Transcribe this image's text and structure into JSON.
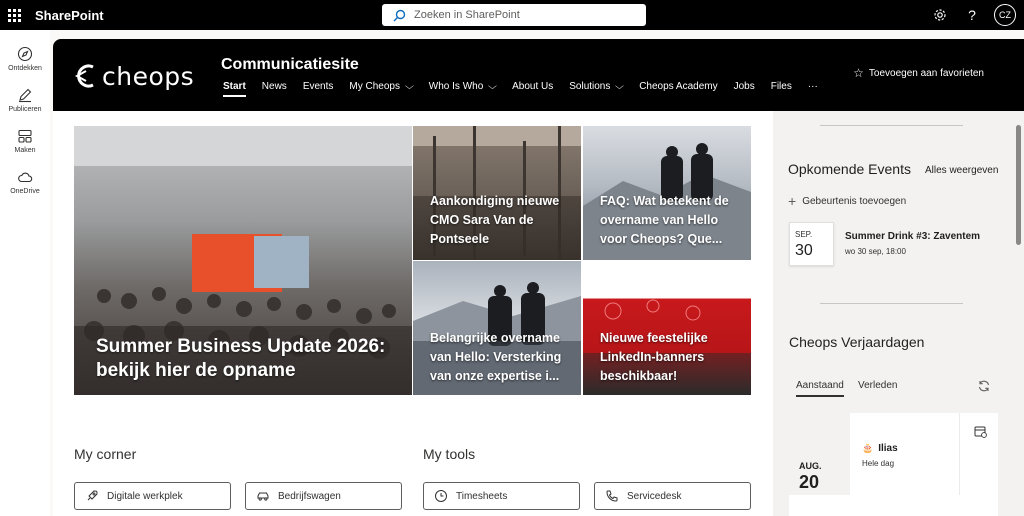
{
  "suitebar": {
    "app_name": "SharePoint",
    "search_placeholder": "Zoeken in SharePoint",
    "avatar_initials": "CZ"
  },
  "appbar": {
    "items": [
      {
        "label": "Ontdekken",
        "icon": "compass-icon"
      },
      {
        "label": "Publiceren",
        "icon": "pen-icon"
      },
      {
        "label": "Maken",
        "icon": "create-icon"
      },
      {
        "label": "OneDrive",
        "icon": "cloud-icon"
      }
    ]
  },
  "site": {
    "logo_text": "cheops",
    "title": "Communicatiesite",
    "nav": [
      {
        "label": "Start",
        "active": true,
        "dropdown": false
      },
      {
        "label": "News",
        "active": false,
        "dropdown": false
      },
      {
        "label": "Events",
        "active": false,
        "dropdown": false
      },
      {
        "label": "My Cheops",
        "active": false,
        "dropdown": true
      },
      {
        "label": "Who Is Who",
        "active": false,
        "dropdown": true
      },
      {
        "label": "About Us",
        "active": false,
        "dropdown": false
      },
      {
        "label": "Solutions",
        "active": false,
        "dropdown": true
      },
      {
        "label": "Cheops Academy",
        "active": false,
        "dropdown": false
      },
      {
        "label": "Jobs",
        "active": false,
        "dropdown": false
      },
      {
        "label": "Files",
        "active": false,
        "dropdown": false
      },
      {
        "label": "···",
        "active": false,
        "dropdown": false
      }
    ],
    "favorite_label": "Toevoegen aan favorieten"
  },
  "hero": {
    "main": "Summer Business Update 2026: bekijk hier de opname",
    "tile_a": "Aankondiging nieuwe CMO Sara Van de Pontseele",
    "tile_b": "FAQ: Wat betekent de overname van Hello voor Cheops? Que...",
    "tile_c": "Belangrijke overname van Hello: Versterking van onze expertise i...",
    "tile_d": "Nieuwe feestelijke LinkedIn-banners beschikbaar!"
  },
  "my_corner": {
    "title": "My corner",
    "links": [
      {
        "label": "Digitale werkplek",
        "icon": "rocket-icon"
      },
      {
        "label": "Bedrijfswagen",
        "icon": "car-icon"
      }
    ]
  },
  "my_tools": {
    "title": "My tools",
    "links": [
      {
        "label": "Timesheets",
        "icon": "clock-icon"
      },
      {
        "label": "Servicedesk",
        "icon": "phone-icon"
      }
    ]
  },
  "events": {
    "title": "Opkomende Events",
    "see_all": "Alles weergeven",
    "add_label": "Gebeurtenis toevoegen",
    "items": [
      {
        "month": "SEP.",
        "day": "30",
        "name": "Summer Drink #3: Zaventem",
        "time": "wo 30 sep, 18:00"
      }
    ]
  },
  "birthdays": {
    "title": "Cheops Verjaardagen",
    "tabs": [
      "Aanstaand",
      "Verleden"
    ],
    "items": [
      {
        "month": "AUG.",
        "day": "20",
        "name": "Ilias",
        "sub": "Hele dag"
      }
    ]
  },
  "colors": {
    "suitebar": "#000000",
    "header": "#000000",
    "accent_red": "#c8191c",
    "rail": "#f3f2f1"
  }
}
